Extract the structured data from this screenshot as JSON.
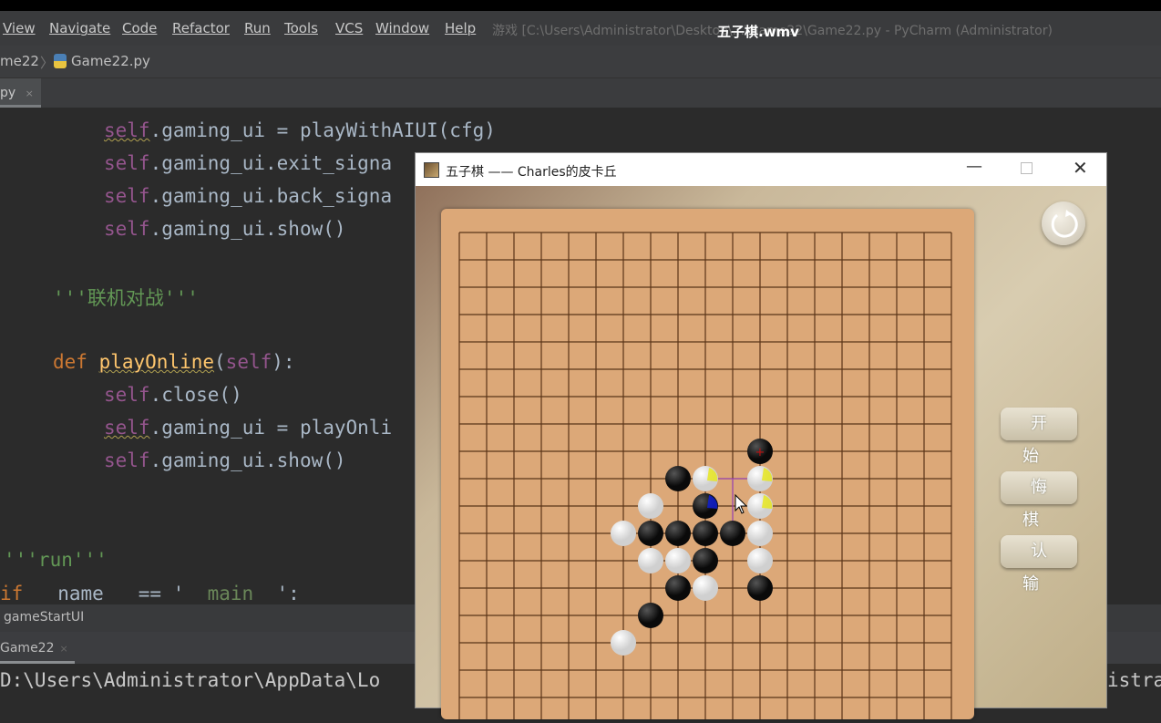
{
  "video_title": "五子棋.wmv",
  "menu": [
    "View",
    "Navigate",
    "Code",
    "Refactor",
    "Run",
    "Tools",
    "VCS",
    "Window",
    "Help"
  ],
  "window_title": "游戏 [C:\\Users\\Administrator\\Desktop\\...\\Game22\\Game22.py - PyCharm (Administrator)",
  "nav": {
    "project": "me22",
    "file": "Game22.py"
  },
  "tab": {
    "label": "py",
    "close": "×"
  },
  "code": {
    "l1a": "self",
    "l1b": ".gaming_ui = playWithAIUI(cfg)",
    "l2a": "self",
    "l2b": ".gaming_ui.exit_signa",
    "l3a": "self",
    "l3b": ".gaming_ui.back_signa",
    "l4a": "self",
    "l4b": ".gaming_ui.show()",
    "l5": "'''联机对战'''",
    "l6a": "def ",
    "l6b": "playOnline",
    "l6c": "(",
    "l6d": "self",
    "l6e": "):",
    "l7a": "self",
    "l7b": ".close()",
    "l8a": "self",
    "l8b": ".gaming_ui = playOnli",
    "l9a": "self",
    "l9b": ".gaming_ui.show()",
    "l10": "'''run'''",
    "l11a": "if",
    "l11b": "   name   == '  ",
    "l11c": "main",
    "l11d": "  ':"
  },
  "breadcrumb": "gameStartUI",
  "run_tab": "Game22",
  "console": {
    "left": "D:\\Users\\Administrator\\AppData\\Lo",
    "right": "istra"
  },
  "game": {
    "title": "五子棋 —— Charles的皮卡丘",
    "buttons": {
      "start": "开始",
      "undo": "悔棋",
      "surrender": "认输"
    },
    "grid_size": 19,
    "stones": [
      {
        "r": 8,
        "c": 11,
        "color": "black",
        "last": true
      },
      {
        "r": 9,
        "c": 8,
        "color": "black"
      },
      {
        "r": 9,
        "c": 9,
        "color": "white",
        "tint": "#e8e820"
      },
      {
        "r": 9,
        "c": 11,
        "color": "white",
        "tint": "#e8e820"
      },
      {
        "r": 10,
        "c": 7,
        "color": "white"
      },
      {
        "r": 10,
        "c": 9,
        "color": "black",
        "tint": "#1020d0"
      },
      {
        "r": 10,
        "c": 11,
        "color": "white",
        "tint": "#e8e820"
      },
      {
        "r": 11,
        "c": 6,
        "color": "white"
      },
      {
        "r": 11,
        "c": 7,
        "color": "black"
      },
      {
        "r": 11,
        "c": 8,
        "color": "black"
      },
      {
        "r": 11,
        "c": 9,
        "color": "black"
      },
      {
        "r": 11,
        "c": 10,
        "color": "black"
      },
      {
        "r": 11,
        "c": 11,
        "color": "white"
      },
      {
        "r": 12,
        "c": 7,
        "color": "white"
      },
      {
        "r": 12,
        "c": 8,
        "color": "white"
      },
      {
        "r": 12,
        "c": 9,
        "color": "black"
      },
      {
        "r": 12,
        "c": 11,
        "color": "white"
      },
      {
        "r": 13,
        "c": 8,
        "color": "black"
      },
      {
        "r": 13,
        "c": 9,
        "color": "white"
      },
      {
        "r": 13,
        "c": 11,
        "color": "black"
      },
      {
        "r": 14,
        "c": 7,
        "color": "black"
      },
      {
        "r": 15,
        "c": 6,
        "color": "white"
      }
    ]
  }
}
